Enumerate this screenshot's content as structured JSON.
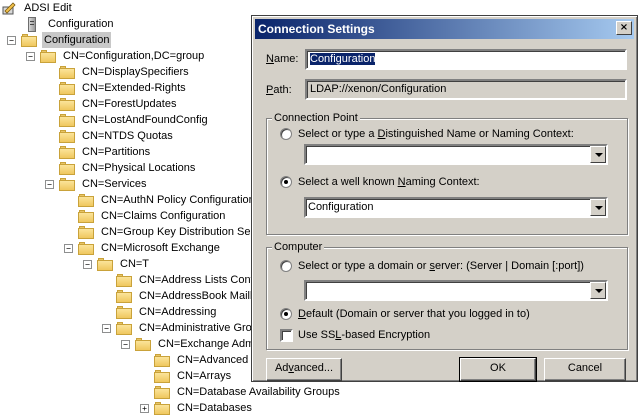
{
  "window_title": "ADSI Edit",
  "tree": {
    "items": [
      {
        "label": "ADSI Edit",
        "icon": "app-icon",
        "depth": 0,
        "expander": ""
      },
      {
        "label": "Configuration",
        "icon": "server-icon",
        "depth": 0,
        "expander": ""
      },
      {
        "label": "Configuration",
        "icon": "folder-icon",
        "depth": 0,
        "expander": "−",
        "selected": true
      },
      {
        "label": "CN=Configuration,DC=group",
        "icon": "folder-icon",
        "depth": 1,
        "expander": "−"
      },
      {
        "label": "CN=DisplaySpecifiers",
        "icon": "folder-icon",
        "depth": 2,
        "expander": ""
      },
      {
        "label": "CN=Extended-Rights",
        "icon": "folder-icon",
        "depth": 2,
        "expander": ""
      },
      {
        "label": "CN=ForestUpdates",
        "icon": "folder-icon",
        "depth": 2,
        "expander": ""
      },
      {
        "label": "CN=LostAndFoundConfig",
        "icon": "folder-icon",
        "depth": 2,
        "expander": ""
      },
      {
        "label": "CN=NTDS Quotas",
        "icon": "folder-icon",
        "depth": 2,
        "expander": ""
      },
      {
        "label": "CN=Partitions",
        "icon": "folder-icon",
        "depth": 2,
        "expander": ""
      },
      {
        "label": "CN=Physical Locations",
        "icon": "folder-icon",
        "depth": 2,
        "expander": ""
      },
      {
        "label": "CN=Services",
        "icon": "folder-icon",
        "depth": 2,
        "expander": "−"
      },
      {
        "label": "CN=AuthN Policy Configuration",
        "icon": "folder-icon",
        "depth": 3,
        "expander": ""
      },
      {
        "label": "CN=Claims Configuration",
        "icon": "folder-icon",
        "depth": 3,
        "expander": ""
      },
      {
        "label": "CN=Group Key Distribution Serv",
        "icon": "folder-icon",
        "depth": 3,
        "expander": ""
      },
      {
        "label": "CN=Microsoft Exchange",
        "icon": "folder-icon",
        "depth": 3,
        "expander": "−"
      },
      {
        "label": "CN=T",
        "icon": "folder-icon",
        "depth": 4,
        "expander": "−"
      },
      {
        "label": "CN=Address Lists Conta",
        "icon": "folder-icon",
        "depth": 5,
        "expander": ""
      },
      {
        "label": "CN=AddressBook Mailbo",
        "icon": "folder-icon",
        "depth": 5,
        "expander": ""
      },
      {
        "label": "CN=Addressing",
        "icon": "folder-icon",
        "depth": 5,
        "expander": ""
      },
      {
        "label": "CN=Administrative Grou",
        "icon": "folder-icon",
        "depth": 5,
        "expander": "−"
      },
      {
        "label": "CN=Exchange Admin",
        "icon": "folder-icon",
        "depth": 6,
        "expander": "−"
      },
      {
        "label": "CN=Advanced S",
        "icon": "folder-icon",
        "depth": 7,
        "expander": ""
      },
      {
        "label": "CN=Arrays",
        "icon": "folder-icon",
        "depth": 7,
        "expander": ""
      },
      {
        "label": "CN=Database Availability Groups",
        "icon": "folder-icon",
        "depth": 7,
        "expander": ""
      },
      {
        "label": "CN=Databases",
        "icon": "folder-icon",
        "depth": 7,
        "expander": "+"
      }
    ]
  },
  "dialog": {
    "title": "Connection Settings",
    "close_glyph": "×",
    "name_label_pre": "",
    "name_label_accel": "N",
    "name_label_post": "ame:",
    "name_value": "Configuration",
    "path_label_pre": "",
    "path_label_accel": "P",
    "path_label_post": "ath:",
    "path_value": "LDAP://xenon/Configuration",
    "connection_point": {
      "title": "Connection Point",
      "dn_option_pre": "Select or type a ",
      "dn_option_accel": "D",
      "dn_option_post": "istinguished Name or Naming Context:",
      "dn_value": "",
      "well_known_pre": "Select a well known ",
      "well_known_accel": "N",
      "well_known_post": "aming Context:",
      "well_known_value": "Configuration",
      "selected": "well_known"
    },
    "computer": {
      "title": "Computer",
      "server_option_pre": "Select or type a domain or ",
      "server_option_accel": "s",
      "server_option_post": "erver: (Server | Domain [:port])",
      "server_value": "",
      "default_pre": "D",
      "default_accel": "e",
      "default_post": "fault (Domain or server that you logged in to)",
      "selected": "default",
      "ssl_pre": "Use SS",
      "ssl_accel": "L",
      "ssl_post": "-based Encryption",
      "ssl_checked": false
    },
    "buttons": {
      "advanced_pre": "Ad",
      "advanced_accel": "v",
      "advanced_post": "anced...",
      "ok": "OK",
      "cancel": "Cancel"
    }
  }
}
